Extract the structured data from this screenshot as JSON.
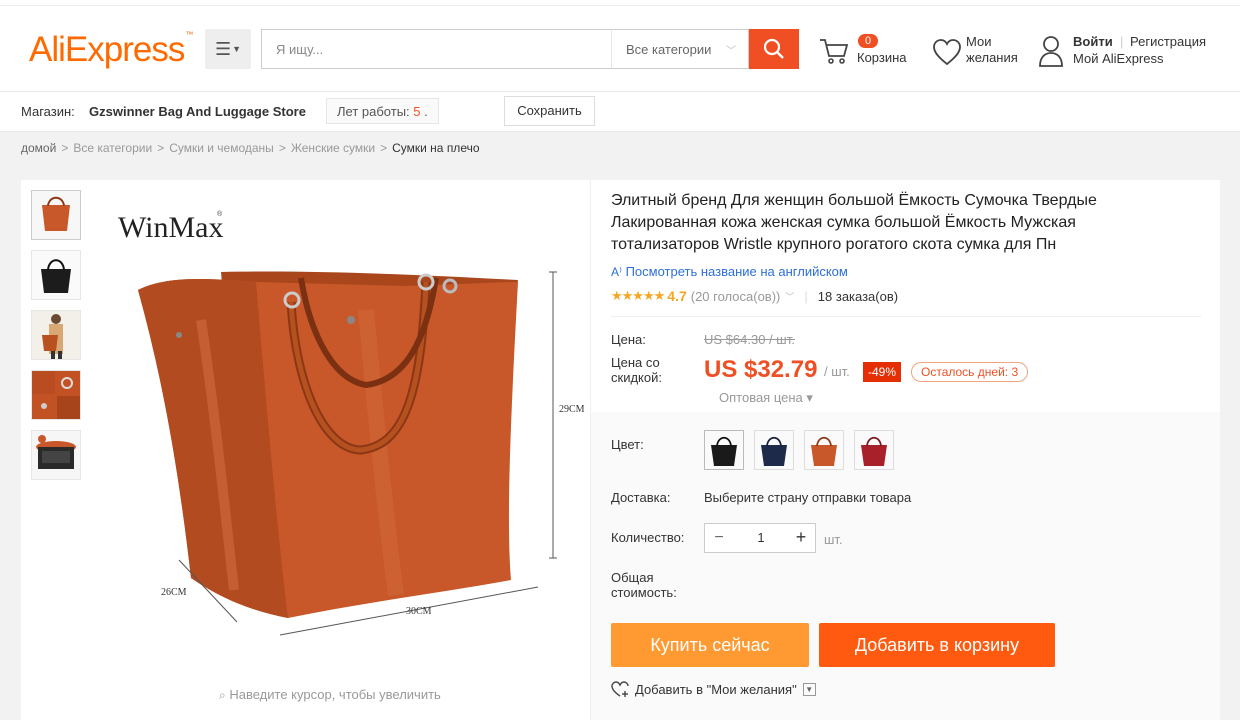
{
  "header": {
    "logo": "AliExpress",
    "logo_tm": "™",
    "search_placeholder": "Я ищу...",
    "category_select": "Все категории",
    "cart_count": "0",
    "cart_label": "Корзина",
    "wishlist_line1": "Мои",
    "wishlist_line2": "желания",
    "login": "Войти",
    "separator": "|",
    "register": "Регистрация",
    "my_account": "Мой AliExpress"
  },
  "store": {
    "label": "Магазин:",
    "name": "Gzswinner Bag And Luggage Store",
    "years_label": "Лет работы:",
    "years_value": "5",
    "years_dot": ".",
    "save_label": "Сохранить"
  },
  "breadcrumb": [
    "домой",
    "Все категории",
    "Сумки и чемоданы",
    "Женские сумки",
    "Сумки на плечо"
  ],
  "breadcrumb_sep": ">",
  "gallery": {
    "brand": "WinMax",
    "dim_height": "29CM",
    "dim_depth": "26CM",
    "dim_width": "30CM",
    "zoom_hint": "Наведите курсор, чтобы увеличить",
    "thumbs": [
      "thumb-orange-bag",
      "thumb-black-bag",
      "thumb-model",
      "thumb-detail",
      "thumb-interior"
    ]
  },
  "product": {
    "title": "Элитный бренд Для женщин большой Ёмкость Сумочка Твердые Лакированная кожа женская сумка большой Ёмкость Мужская тотализаторов Wristle крупного рогатого скота сумка для Пн",
    "translate_link": "Посмотреть название на английском",
    "stars": "★★★★★",
    "rating": "4.7",
    "votes": "(20 голоса(ов))",
    "orders": "18 заказа(ов)",
    "price_label": "Цена:",
    "old_price": "US $64.30 / шт.",
    "discount_label": "Цена со скидкой:",
    "new_price": "US $32.79",
    "per_unit": "/ шт.",
    "discount_badge": "-49%",
    "days_left": "Осталось дней: 3",
    "wholesale": "Оптовая цена ▾",
    "color_label": "Цвет:",
    "colors": [
      "black",
      "navy",
      "brown",
      "red"
    ],
    "shipping_label": "Доставка:",
    "shipping_value": "Выберите страну отправки товара",
    "qty_label": "Количество:",
    "qty_value": "1",
    "qty_unit": "шт.",
    "total_label": "Общая стоимость:",
    "buy_now": "Купить сейчас",
    "add_to_cart": "Добавить в корзину",
    "add_wishlist": "Добавить в \"Мои желания\""
  },
  "colors": {
    "accent": "#f04e23",
    "buy_now": "#ff9a32",
    "add_cart": "#ff5a10",
    "bag": "#c8582a",
    "link": "#2e6fd8",
    "star": "#f5a623"
  }
}
